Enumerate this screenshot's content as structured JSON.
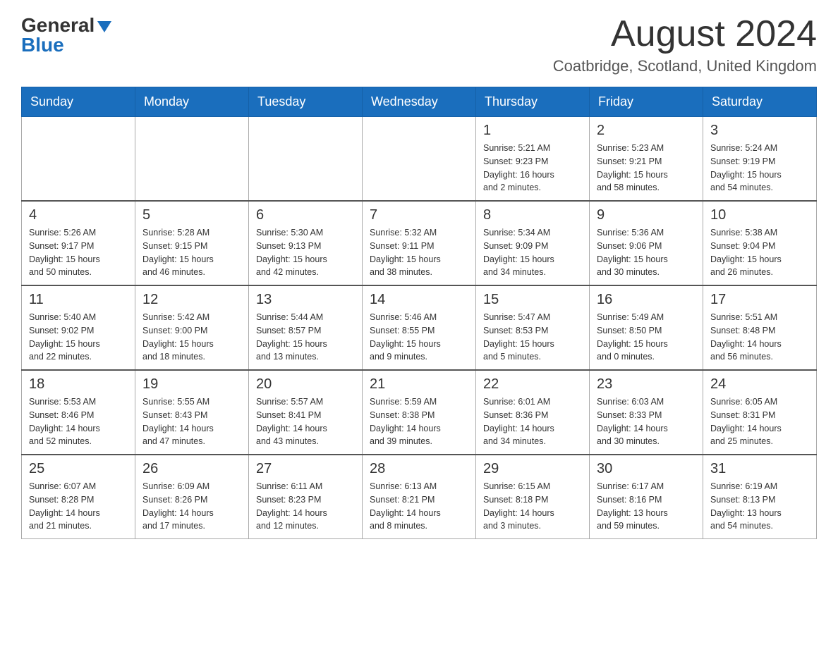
{
  "header": {
    "logo_general": "General",
    "logo_blue": "Blue",
    "month_title": "August 2024",
    "location": "Coatbridge, Scotland, United Kingdom"
  },
  "weekdays": [
    "Sunday",
    "Monday",
    "Tuesday",
    "Wednesday",
    "Thursday",
    "Friday",
    "Saturday"
  ],
  "weeks": [
    [
      {
        "day": "",
        "info": ""
      },
      {
        "day": "",
        "info": ""
      },
      {
        "day": "",
        "info": ""
      },
      {
        "day": "",
        "info": ""
      },
      {
        "day": "1",
        "info": "Sunrise: 5:21 AM\nSunset: 9:23 PM\nDaylight: 16 hours\nand 2 minutes."
      },
      {
        "day": "2",
        "info": "Sunrise: 5:23 AM\nSunset: 9:21 PM\nDaylight: 15 hours\nand 58 minutes."
      },
      {
        "day": "3",
        "info": "Sunrise: 5:24 AM\nSunset: 9:19 PM\nDaylight: 15 hours\nand 54 minutes."
      }
    ],
    [
      {
        "day": "4",
        "info": "Sunrise: 5:26 AM\nSunset: 9:17 PM\nDaylight: 15 hours\nand 50 minutes."
      },
      {
        "day": "5",
        "info": "Sunrise: 5:28 AM\nSunset: 9:15 PM\nDaylight: 15 hours\nand 46 minutes."
      },
      {
        "day": "6",
        "info": "Sunrise: 5:30 AM\nSunset: 9:13 PM\nDaylight: 15 hours\nand 42 minutes."
      },
      {
        "day": "7",
        "info": "Sunrise: 5:32 AM\nSunset: 9:11 PM\nDaylight: 15 hours\nand 38 minutes."
      },
      {
        "day": "8",
        "info": "Sunrise: 5:34 AM\nSunset: 9:09 PM\nDaylight: 15 hours\nand 34 minutes."
      },
      {
        "day": "9",
        "info": "Sunrise: 5:36 AM\nSunset: 9:06 PM\nDaylight: 15 hours\nand 30 minutes."
      },
      {
        "day": "10",
        "info": "Sunrise: 5:38 AM\nSunset: 9:04 PM\nDaylight: 15 hours\nand 26 minutes."
      }
    ],
    [
      {
        "day": "11",
        "info": "Sunrise: 5:40 AM\nSunset: 9:02 PM\nDaylight: 15 hours\nand 22 minutes."
      },
      {
        "day": "12",
        "info": "Sunrise: 5:42 AM\nSunset: 9:00 PM\nDaylight: 15 hours\nand 18 minutes."
      },
      {
        "day": "13",
        "info": "Sunrise: 5:44 AM\nSunset: 8:57 PM\nDaylight: 15 hours\nand 13 minutes."
      },
      {
        "day": "14",
        "info": "Sunrise: 5:46 AM\nSunset: 8:55 PM\nDaylight: 15 hours\nand 9 minutes."
      },
      {
        "day": "15",
        "info": "Sunrise: 5:47 AM\nSunset: 8:53 PM\nDaylight: 15 hours\nand 5 minutes."
      },
      {
        "day": "16",
        "info": "Sunrise: 5:49 AM\nSunset: 8:50 PM\nDaylight: 15 hours\nand 0 minutes."
      },
      {
        "day": "17",
        "info": "Sunrise: 5:51 AM\nSunset: 8:48 PM\nDaylight: 14 hours\nand 56 minutes."
      }
    ],
    [
      {
        "day": "18",
        "info": "Sunrise: 5:53 AM\nSunset: 8:46 PM\nDaylight: 14 hours\nand 52 minutes."
      },
      {
        "day": "19",
        "info": "Sunrise: 5:55 AM\nSunset: 8:43 PM\nDaylight: 14 hours\nand 47 minutes."
      },
      {
        "day": "20",
        "info": "Sunrise: 5:57 AM\nSunset: 8:41 PM\nDaylight: 14 hours\nand 43 minutes."
      },
      {
        "day": "21",
        "info": "Sunrise: 5:59 AM\nSunset: 8:38 PM\nDaylight: 14 hours\nand 39 minutes."
      },
      {
        "day": "22",
        "info": "Sunrise: 6:01 AM\nSunset: 8:36 PM\nDaylight: 14 hours\nand 34 minutes."
      },
      {
        "day": "23",
        "info": "Sunrise: 6:03 AM\nSunset: 8:33 PM\nDaylight: 14 hours\nand 30 minutes."
      },
      {
        "day": "24",
        "info": "Sunrise: 6:05 AM\nSunset: 8:31 PM\nDaylight: 14 hours\nand 25 minutes."
      }
    ],
    [
      {
        "day": "25",
        "info": "Sunrise: 6:07 AM\nSunset: 8:28 PM\nDaylight: 14 hours\nand 21 minutes."
      },
      {
        "day": "26",
        "info": "Sunrise: 6:09 AM\nSunset: 8:26 PM\nDaylight: 14 hours\nand 17 minutes."
      },
      {
        "day": "27",
        "info": "Sunrise: 6:11 AM\nSunset: 8:23 PM\nDaylight: 14 hours\nand 12 minutes."
      },
      {
        "day": "28",
        "info": "Sunrise: 6:13 AM\nSunset: 8:21 PM\nDaylight: 14 hours\nand 8 minutes."
      },
      {
        "day": "29",
        "info": "Sunrise: 6:15 AM\nSunset: 8:18 PM\nDaylight: 14 hours\nand 3 minutes."
      },
      {
        "day": "30",
        "info": "Sunrise: 6:17 AM\nSunset: 8:16 PM\nDaylight: 13 hours\nand 59 minutes."
      },
      {
        "day": "31",
        "info": "Sunrise: 6:19 AM\nSunset: 8:13 PM\nDaylight: 13 hours\nand 54 minutes."
      }
    ]
  ]
}
